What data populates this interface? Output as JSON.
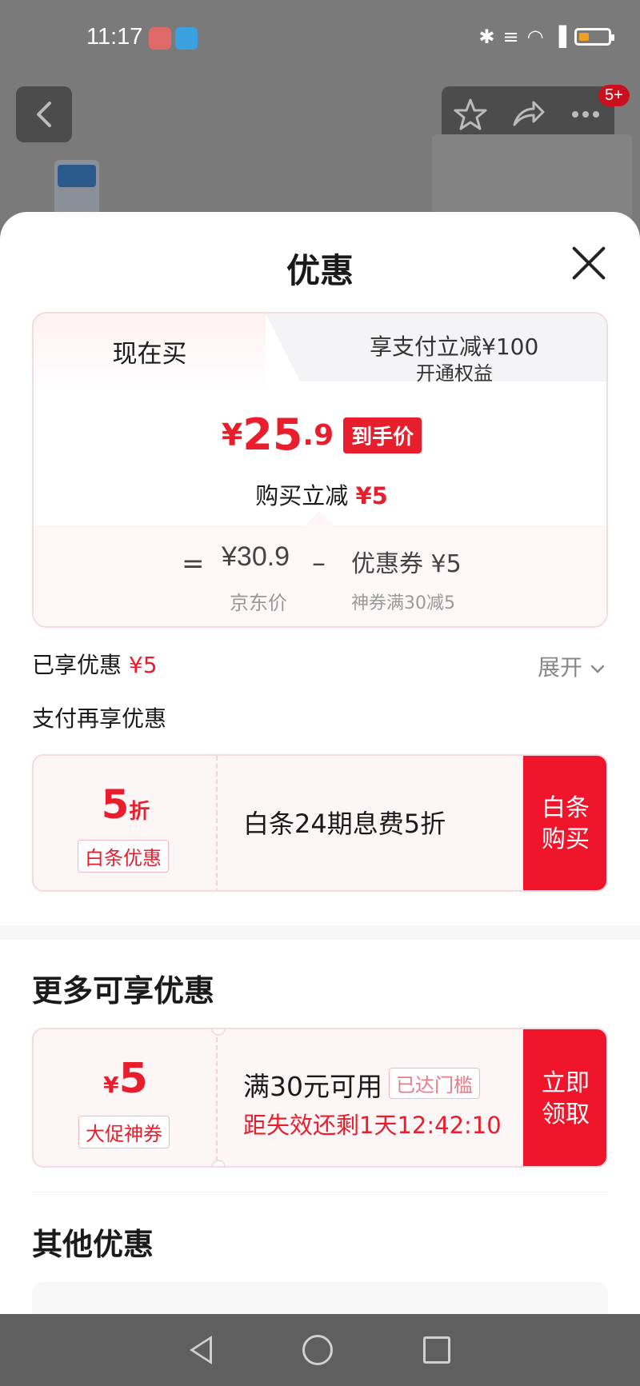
{
  "status_bar": {
    "time": "11:17",
    "battery_color": "#f0a020"
  },
  "header": {
    "badge_count": "5+"
  },
  "sheet": {
    "title": "优惠",
    "tabs": {
      "now": "现在买",
      "pay_line1": "享支付立减¥100",
      "pay_line2": "开通权益"
    },
    "final_price": {
      "yen": "¥",
      "integer": "25",
      "decimal": ".9",
      "tag": "到手价"
    },
    "buy_discount": {
      "label": "购买立减",
      "amount": "¥5"
    },
    "calc": {
      "equals": "=",
      "jd_price": "¥30.9",
      "jd_label": "京东价",
      "minus": "–",
      "coupon": "优惠券 ¥5",
      "coupon_desc": "神券满30减5"
    },
    "enjoyed": {
      "label": "已享优惠",
      "amount": "¥5"
    },
    "expand": "展开",
    "pay_more": "支付再享优惠",
    "baitiao": {
      "number": "5",
      "unit": "折",
      "tag": "白条优惠",
      "text": "白条24期息费5折",
      "button_line1": "白条",
      "button_line2": "购买"
    },
    "more_heading": "更多可享优惠",
    "coupon": {
      "symbol": "¥",
      "amount": "5",
      "tag": "大促神券",
      "condition": "满30元可用",
      "badge": "已达门槛",
      "timer": "距失效还剩1天12:42:10",
      "button_line1": "立即",
      "button_line2": "领取"
    },
    "other_heading": "其他优惠"
  },
  "colors": {
    "accent": "#e91e2c",
    "button_red": "#f0152b"
  }
}
